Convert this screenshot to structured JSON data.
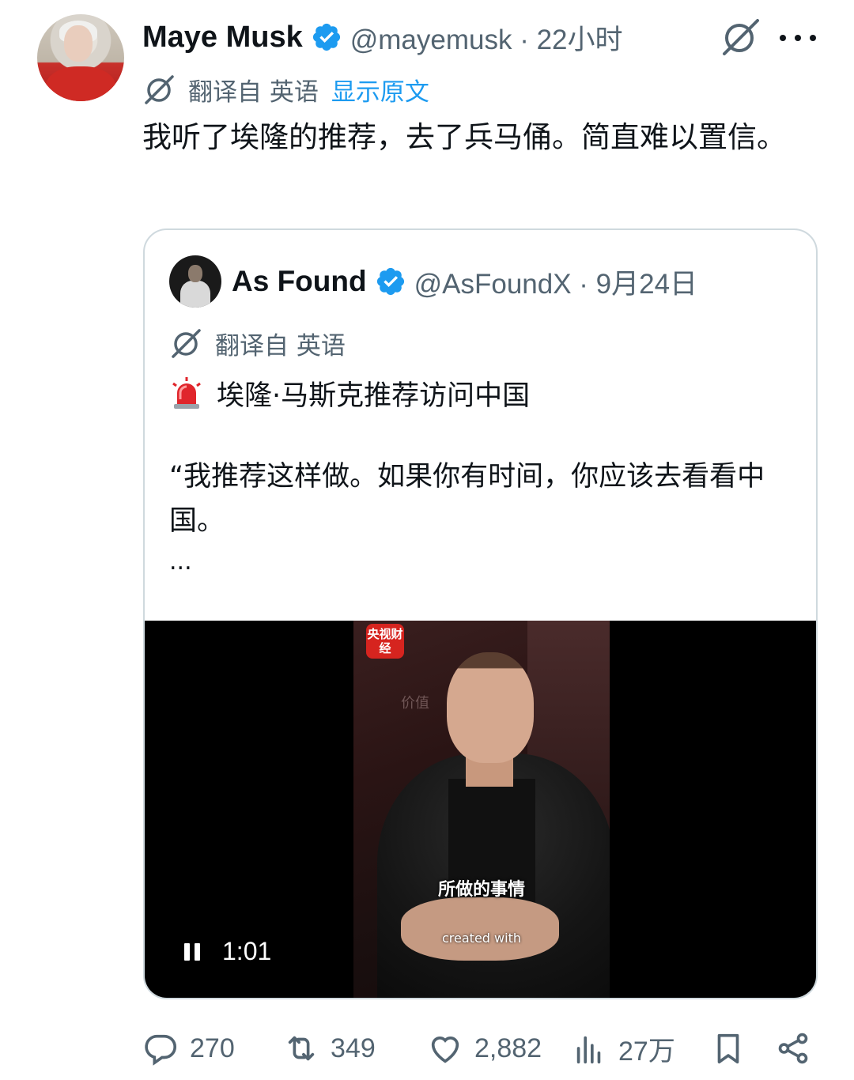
{
  "tweet": {
    "author_name": "Maye Musk",
    "handle_meta": "@mayemusk · 22小时",
    "translated_label": "翻译自 英语",
    "show_original": "显示原文",
    "text": "我听了埃隆的推荐，去了兵马俑。简直难以置信。"
  },
  "quoted": {
    "author_name": "As Found",
    "handle_meta": "@AsFoundX · 9月24日",
    "translated_label": "翻译自 英语",
    "headline": "埃隆·马斯克推荐访问中国",
    "body": "“我推荐这样做。如果你有时间，你应该去看看中国。",
    "ellipsis": "...",
    "video": {
      "logo_text": "央视财经",
      "wall_text": "价值",
      "subtitle": "所做的事情",
      "watermark": "created with",
      "time": "1:01",
      "state": "playing"
    }
  },
  "actions": {
    "replies": "270",
    "reposts": "349",
    "likes": "2,882",
    "views": "27万"
  },
  "colors": {
    "accent": "#1d9bf0",
    "secondary_text": "#536471",
    "primary_text": "#0f1419",
    "border": "#cfd9de"
  },
  "icons": [
    "grok-icon",
    "more-icon",
    "verified-icon",
    "translate-globe-icon",
    "siren-icon",
    "pause-icon",
    "reply-icon",
    "repost-icon",
    "like-icon",
    "views-icon",
    "bookmark-icon",
    "share-icon"
  ]
}
